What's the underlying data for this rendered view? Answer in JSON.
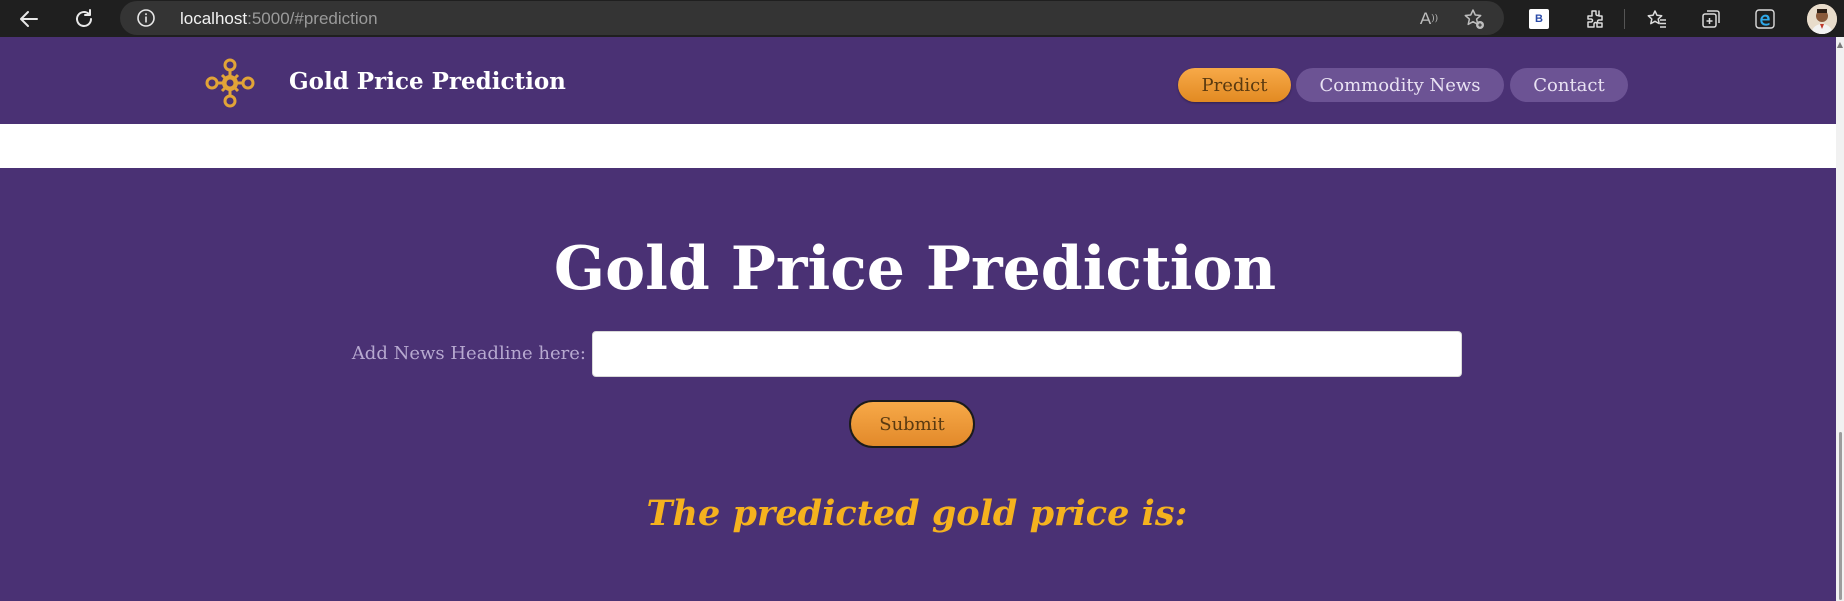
{
  "browser": {
    "url_host": "localhost",
    "url_rest": ":5000/#prediction",
    "read_aloud_label": "A",
    "extension_badge": "B"
  },
  "header": {
    "site_title": "Gold Price Prediction",
    "nav": [
      {
        "label": "Predict",
        "active": true
      },
      {
        "label": "Commodity News",
        "active": false
      },
      {
        "label": "Contact",
        "active": false
      }
    ]
  },
  "main": {
    "heading": "Gold Price Prediction",
    "input_label": "Add News Headline here:",
    "input_value": "",
    "input_placeholder": "",
    "submit_label": "Submit",
    "result_text": "The predicted gold price is:"
  },
  "colors": {
    "brand_purple": "#4a3174",
    "accent_orange": "#f0992f",
    "result_gold": "#f5b21e",
    "inactive_pill": "#6c5394"
  },
  "icons": [
    "back-icon",
    "refresh-icon",
    "site-info-icon",
    "read-aloud-icon",
    "favorite-add-icon",
    "extension-b-icon",
    "extensions-icon",
    "favorites-icon",
    "collections-icon",
    "edge-icon",
    "profile-avatar",
    "gold-logo-icon"
  ]
}
